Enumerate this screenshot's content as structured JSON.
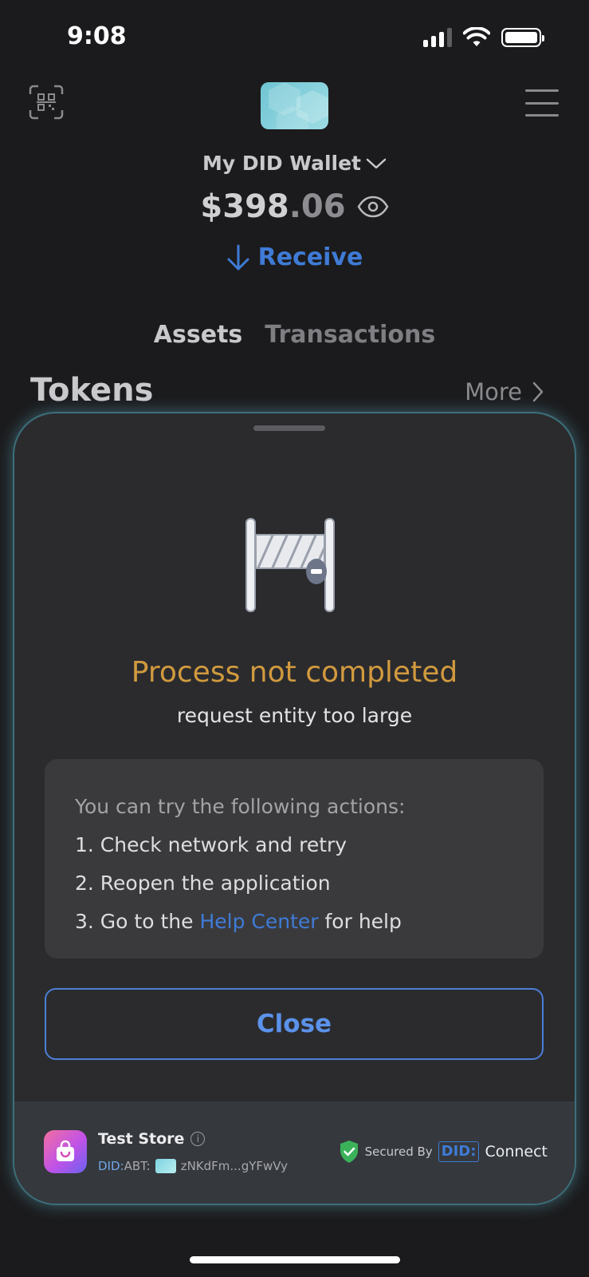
{
  "status_bar": {
    "time": "9:08"
  },
  "header": {
    "wallet_name": "My DID Wallet",
    "balance_main": "$398",
    "balance_cents": ".06",
    "receive_label": "Receive"
  },
  "tabs": [
    {
      "label": "Assets",
      "active": true
    },
    {
      "label": "Transactions",
      "active": false
    }
  ],
  "tokens": {
    "title": "Tokens",
    "more_label": "More"
  },
  "sheet": {
    "title": "Process not completed",
    "subtitle": "request entity too large",
    "actions_intro": "You can try the following actions:",
    "actions": [
      "1. Check network and retry",
      "2. Reopen the application"
    ],
    "action3_prefix": "3. Go to the",
    "action3_link": "Help Center",
    "action3_suffix": "for help",
    "close_label": "Close",
    "colors": {
      "title": "#d19a3e",
      "link": "#3f7bd6",
      "background": "#2b2b2e"
    }
  },
  "footer": {
    "store_name": "Test Store",
    "did_prefix": "DID:",
    "did_abt": "ABT:",
    "did_address": "zNKdFm...gYFwVy",
    "secured_label": "Secured By",
    "did_badge": "DID:",
    "connect_label": "Connect"
  }
}
